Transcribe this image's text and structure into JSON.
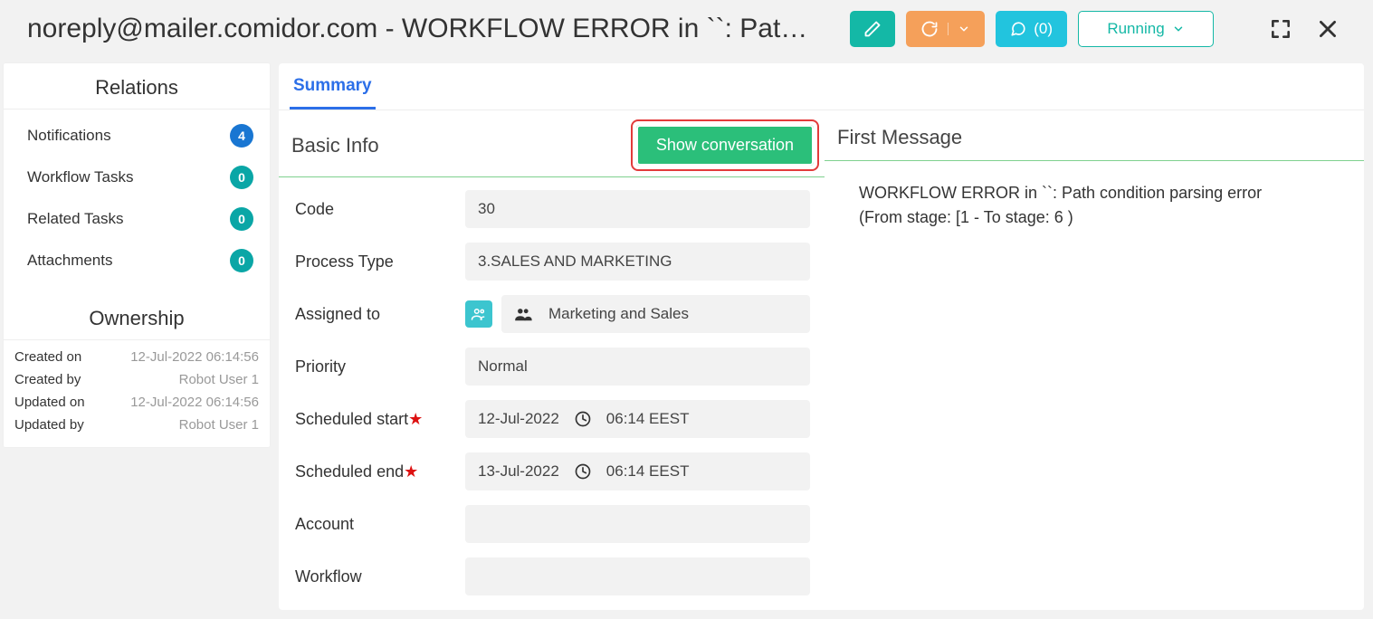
{
  "header": {
    "title": "noreply@mailer.comidor.com - WORKFLOW ERROR in ``: Path co...",
    "comments_label": "(0)",
    "status_label": "Running"
  },
  "sidebar": {
    "relations_title": "Relations",
    "items": [
      {
        "label": "Notifications",
        "count": "4",
        "badge": "blue"
      },
      {
        "label": "Workflow Tasks",
        "count": "0",
        "badge": "teal"
      },
      {
        "label": "Related Tasks",
        "count": "0",
        "badge": "teal"
      },
      {
        "label": "Attachments",
        "count": "0",
        "badge": "teal"
      }
    ],
    "ownership_title": "Ownership",
    "ownership": {
      "created_on_k": "Created on",
      "created_on_v": "12-Jul-2022 06:14:56",
      "created_by_k": "Created by",
      "created_by_v": "Robot User 1",
      "updated_on_k": "Updated on",
      "updated_on_v": "12-Jul-2022 06:14:56",
      "updated_by_k": "Updated by",
      "updated_by_v": "Robot User 1"
    }
  },
  "tabs": {
    "summary": "Summary"
  },
  "basic_info": {
    "title": "Basic Info",
    "show_conversation": "Show conversation",
    "fields": {
      "code_k": "Code",
      "code_v": "30",
      "ptype_k": "Process Type",
      "ptype_v": "3.SALES AND MARKETING",
      "assigned_k": "Assigned to",
      "assigned_v": "Marketing and Sales",
      "priority_k": "Priority",
      "priority_v": "Normal",
      "sched_start_k": "Scheduled start",
      "sched_start_date": "12-Jul-2022",
      "sched_start_time": "06:14 EEST",
      "sched_end_k": "Scheduled end",
      "sched_end_date": "13-Jul-2022",
      "sched_end_time": "06:14 EEST",
      "account_k": "Account",
      "account_v": "",
      "workflow_k": "Workflow",
      "workflow_v": ""
    }
  },
  "first_message": {
    "title": "First Message",
    "body": "WORKFLOW ERROR in ``: Path condition parsing error (From stage: [1 - To stage: 6 )"
  }
}
